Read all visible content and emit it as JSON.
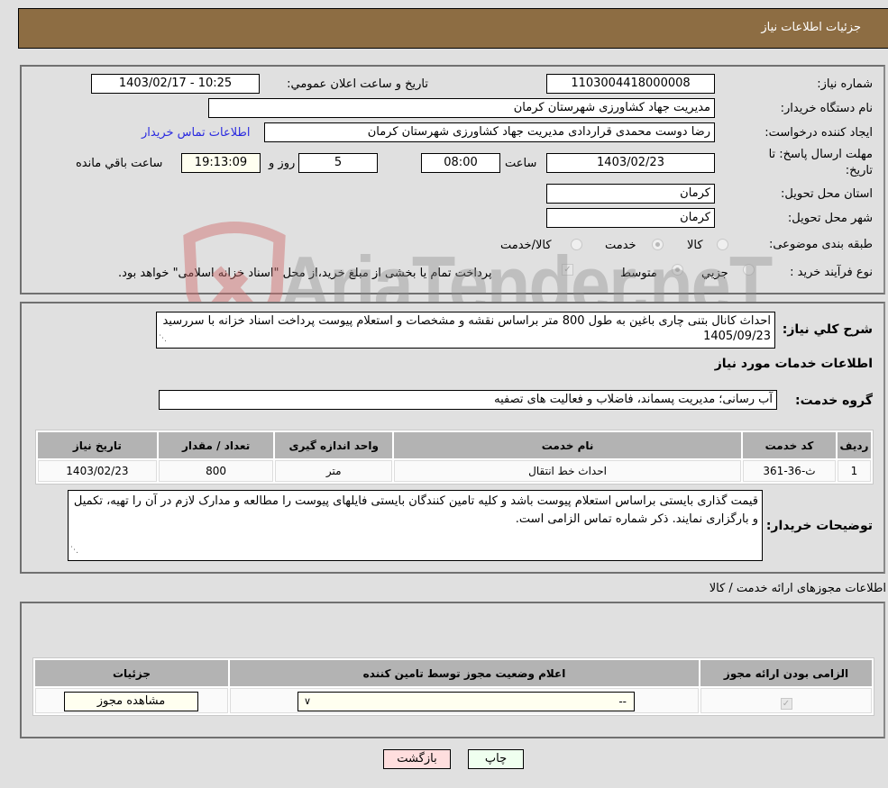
{
  "header": {
    "title": "جزئیات اطلاعات نیاز"
  },
  "need_info": {
    "need_number_label": "شماره نیاز:",
    "need_number": "1103004418000008",
    "announce_label": "تاریخ و ساعت اعلان عمومي:",
    "announce_value": "1403/02/17 - 10:25",
    "buyer_org_label": "نام دستگاه خریدار:",
    "buyer_org": "مدیریت جهاد کشاورزی شهرستان کرمان",
    "requester_label": "ایجاد کننده درخواست:",
    "requester": "رضا دوست محمدی قراردادی مدیریت جهاد کشاورزی شهرستان کرمان",
    "contact_link": "اطلاعات تماس خریدار",
    "deadline_label_1": "مهلت ارسال پاسخ: تا",
    "deadline_label_2": "تاریخ:",
    "deadline_date": "1403/02/23",
    "time_label": "ساعت",
    "deadline_time": "08:00",
    "days_value": "5",
    "days_label": "روز و",
    "remaining_time": "19:13:09",
    "remaining_label": "ساعت باقي مانده",
    "province_label": "استان محل تحویل:",
    "province": "کرمان",
    "city_label": "شهر محل تحویل:",
    "city": "کرمان",
    "category_label": "طبقه بندی موضوعی:",
    "category_options": [
      {
        "label": "کالا",
        "checked": false
      },
      {
        "label": "خدمت",
        "checked": true
      },
      {
        "label": "کالا/خدمت",
        "checked": false
      }
    ],
    "process_label": "نوع فرآیند خرید :",
    "process_options": [
      {
        "label": "جزيي",
        "checked": false
      },
      {
        "label": "متوسط",
        "checked": true
      }
    ],
    "treasury_checkbox_checked": true,
    "treasury_text": "پرداخت تمام یا بخشی از مبلغ خرید،از محل \"اسناد خزانه اسلامی\" خواهد بود."
  },
  "watermark": {
    "text": "AriaTender.neT"
  },
  "description": {
    "label": "شرح کلي نیاز:",
    "text": "احداث کانال بتنی چاری باغین به طول 800 متر براساس نقشه و مشخصات و استعلام پیوست پرداخت اسناد خزانه با سررسید 1405/09/23"
  },
  "services": {
    "section_title": "اطلاعات خدمات مورد نیاز",
    "group_label": "گروه خدمت:",
    "group_value": "آب رسانی؛ مدیریت پسماند، فاضلاب و فعالیت های تصفیه",
    "table": {
      "headers": [
        "ردیف",
        "کد خدمت",
        "نام خدمت",
        "واحد اندازه گیری",
        "تعداد / مقدار",
        "تاریخ نیاز"
      ],
      "rows": [
        [
          "1",
          "ث-36-361",
          "احداث خط انتقال",
          "متر",
          "800",
          "1403/02/23"
        ]
      ]
    },
    "buyer_notes_label": "توضیحات خریدار:",
    "buyer_notes": "قیمت گذاری بایستی براساس استعلام پیوست باشد و کلیه تامین کنندگان بایستی فایلهای پیوست را مطالعه و مدارک لازم در آن را تهیه، تکمیل و بارگزاری نمایند. ذکر شماره تماس الزامی است."
  },
  "permits": {
    "section_title": "اطلاعات مجوزهای ارائه خدمت / کالا",
    "headers": [
      "الزامی بودن ارائه مجوز",
      "اعلام وضعیت مجوز توسط تامین کننده",
      "جزئیات"
    ],
    "row": {
      "required_checked": true,
      "status_value": "--",
      "details_button": "مشاهده مجوز"
    }
  },
  "footer": {
    "print_label": "چاپ",
    "back_label": "بازگشت"
  },
  "colors": {
    "header_bg": "#8d6d43",
    "print_bg": "#efffef",
    "back_bg": "#ffdede",
    "link": "#2a2ae0"
  }
}
